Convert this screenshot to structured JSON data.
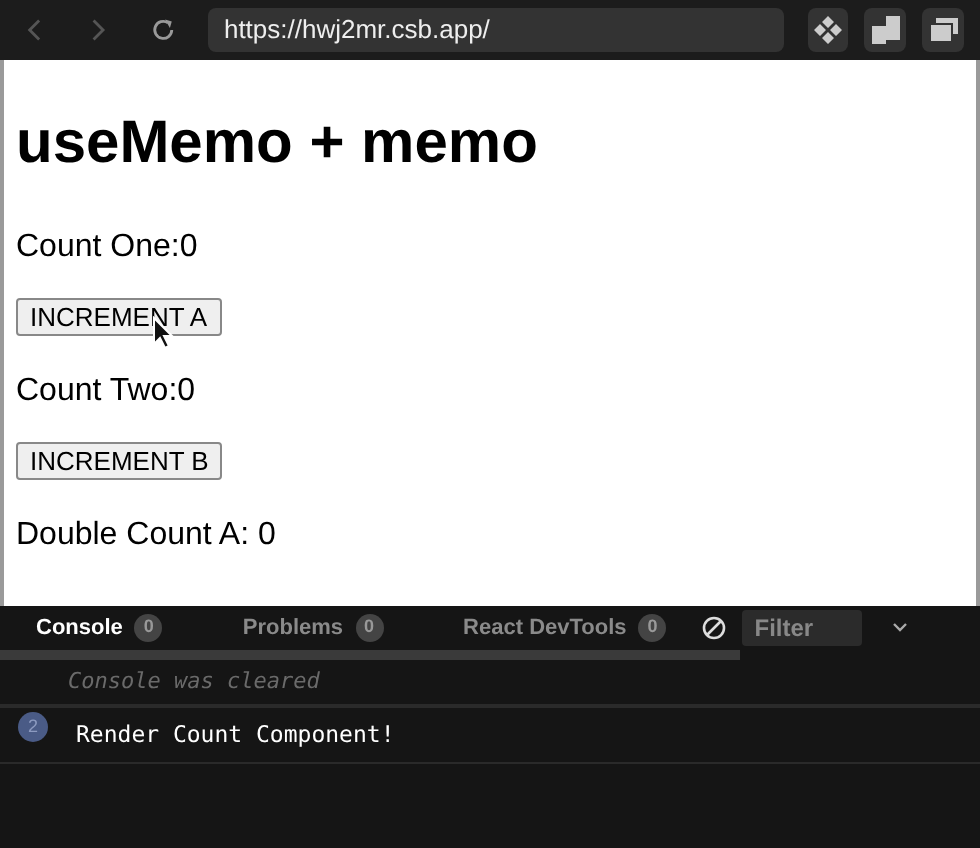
{
  "browser": {
    "url": "https://hwj2mr.csb.app/"
  },
  "page": {
    "title": "useMemo + memo",
    "items": [
      {
        "kind": "text",
        "text": "Count One:0"
      },
      {
        "kind": "button",
        "text": "INCREMENT A"
      },
      {
        "kind": "text",
        "text": "Count Two:0"
      },
      {
        "kind": "button",
        "text": "INCREMENT B"
      },
      {
        "kind": "text",
        "text": "Double Count A: 0"
      }
    ]
  },
  "devtools": {
    "tabs": [
      {
        "label": "Console",
        "count": "0",
        "selected": true
      },
      {
        "label": "Problems",
        "count": "0",
        "selected": false
      },
      {
        "label": "React DevTools",
        "count": "0",
        "selected": false
      }
    ],
    "filter": {
      "placeholder": "Filter"
    },
    "notice": "Console was cleared",
    "logs": [
      {
        "count": "2",
        "text": "Render Count Component!"
      }
    ]
  }
}
